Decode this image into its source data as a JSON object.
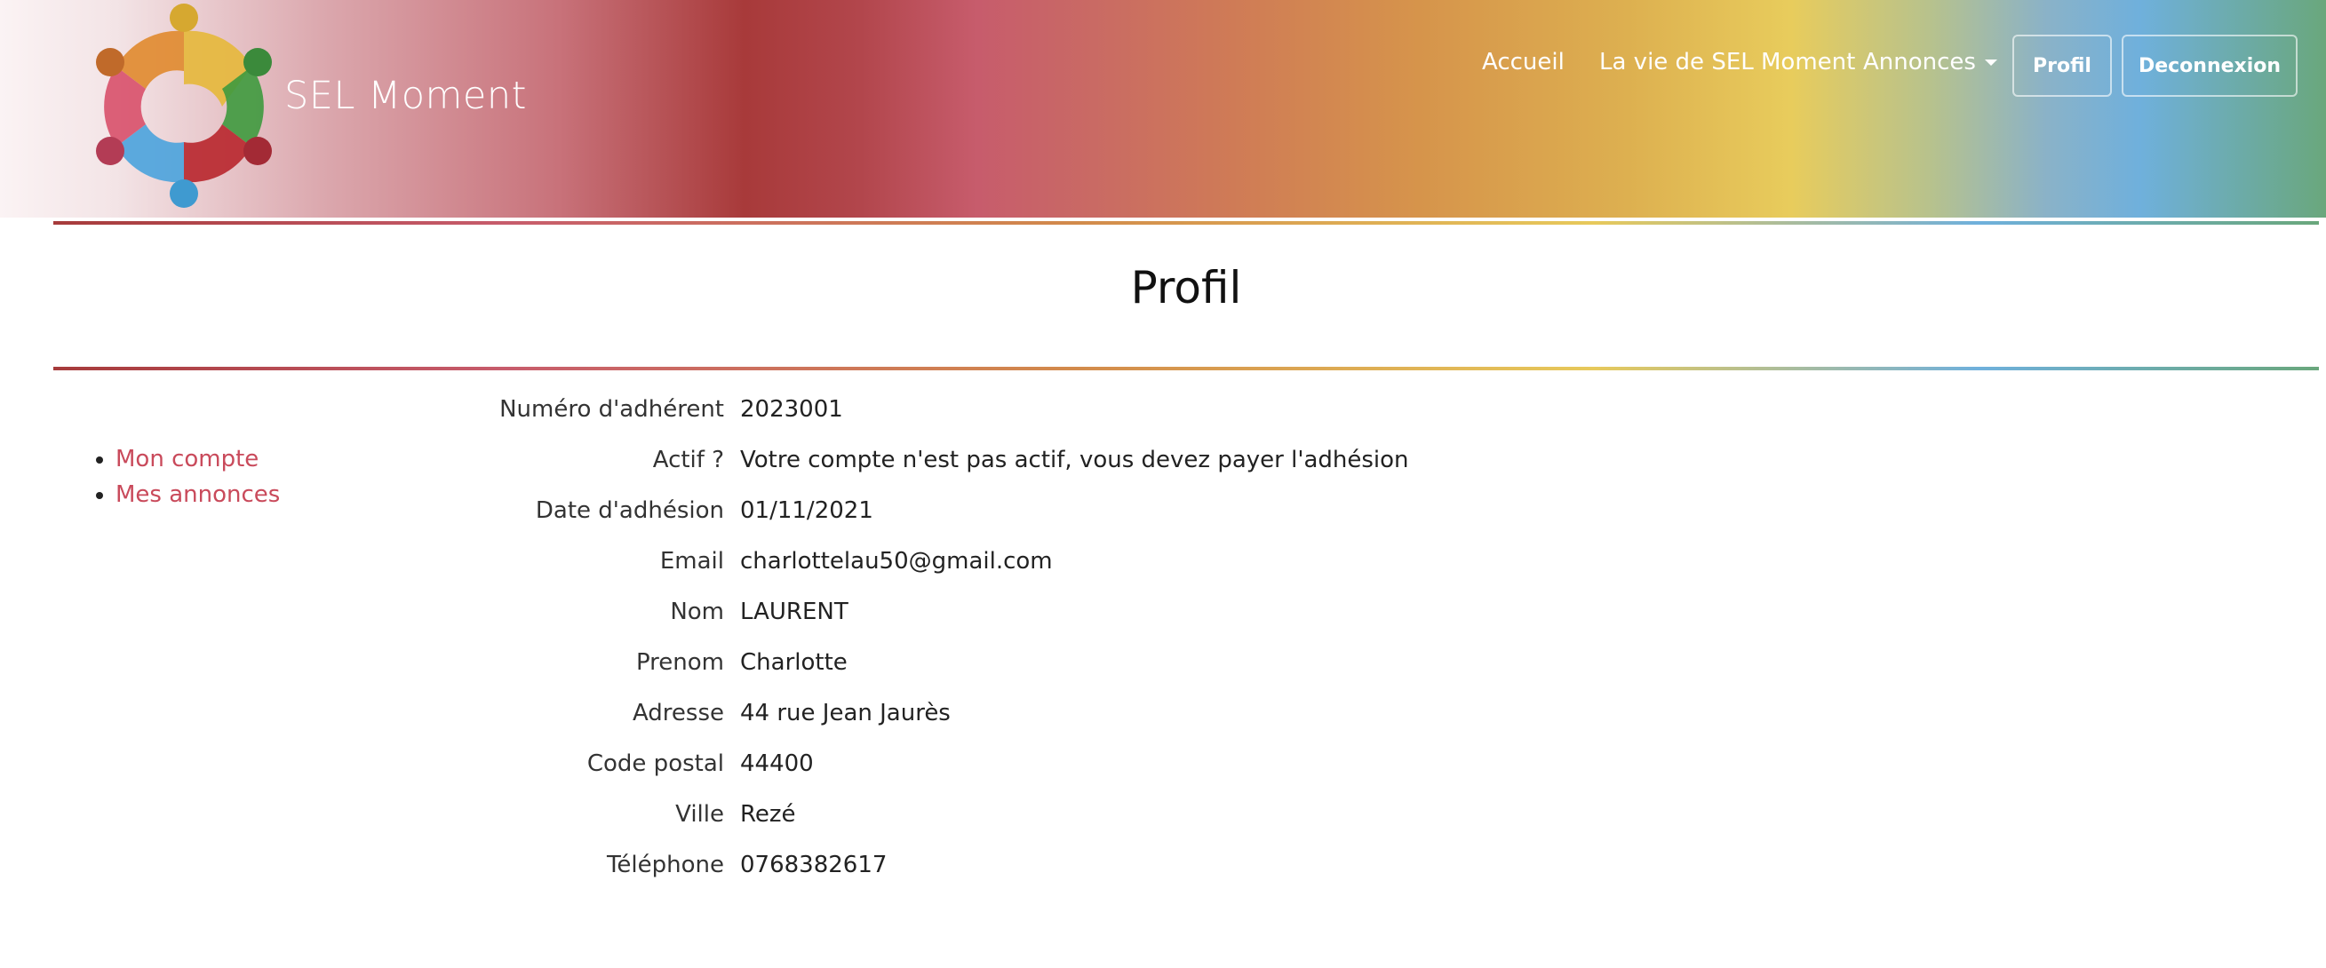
{
  "brand": {
    "name": "SEL Moment"
  },
  "nav": {
    "links": [
      "Accueil",
      "La vie de SEL Moment",
      "Annonces"
    ],
    "buttons": [
      "Profil",
      "Deconnexion"
    ]
  },
  "page": {
    "title": "Profil"
  },
  "sidebar": {
    "items": [
      "Mon compte",
      "Mes annonces"
    ]
  },
  "profile": {
    "fields": [
      {
        "label": "Numéro d'adhérent",
        "value": "2023001"
      },
      {
        "label": "Actif ?",
        "value": "Votre compte n'est pas actif, vous devez payer l'adhésion"
      },
      {
        "label": "Date d'adhésion",
        "value": "01/11/2021"
      },
      {
        "label": "Email",
        "value": "charlottelau50@gmail.com"
      },
      {
        "label": "Nom",
        "value": "LAURENT"
      },
      {
        "label": "Prenom",
        "value": "Charlotte"
      },
      {
        "label": "Adresse",
        "value": "44 rue Jean Jaurès"
      },
      {
        "label": "Code postal",
        "value": "44400"
      },
      {
        "label": "Ville",
        "value": "Rezé"
      },
      {
        "label": "Téléphone",
        "value": "0768382617"
      }
    ]
  },
  "colors": {
    "link": "#c94a5b",
    "accent_red": "#a63b3b"
  },
  "icons": [
    "sel-moment-logo-icon",
    "chevron-down-icon"
  ]
}
